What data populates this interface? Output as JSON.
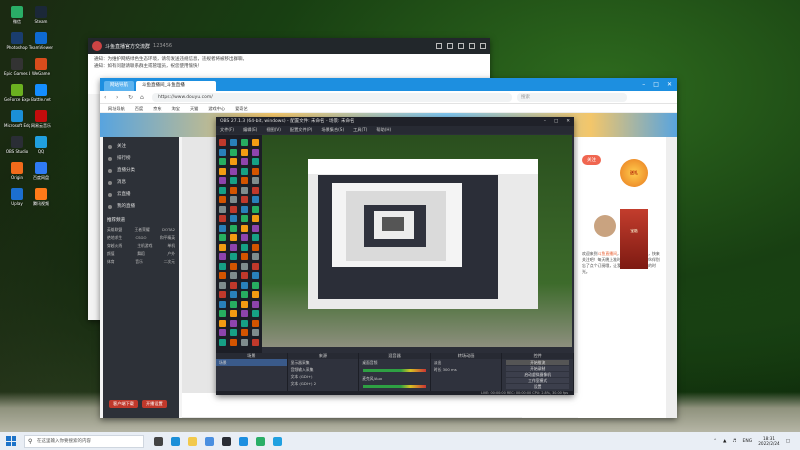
{
  "desktop": {
    "icons": [
      {
        "label": "微信",
        "color": "#2aae67"
      },
      {
        "label": "Photoshop",
        "color": "#1a3d6e"
      },
      {
        "label": "Epic Games Launcher",
        "color": "#333"
      },
      {
        "label": "GeForce Experience",
        "color": "#6bb120"
      },
      {
        "label": "Microsoft Edge",
        "color": "#1b8fd8"
      },
      {
        "label": "OBS Studio",
        "color": "#2a2d35"
      },
      {
        "label": "Origin",
        "color": "#f26b1b"
      },
      {
        "label": "Uplay",
        "color": "#1c6fd0"
      },
      {
        "label": "Steam",
        "color": "#1b2838"
      },
      {
        "label": "TeamViewer",
        "color": "#0e6ad1"
      },
      {
        "label": "WeGame",
        "color": "#d74c1c"
      },
      {
        "label": "Battle.net",
        "color": "#148eff"
      },
      {
        "label": "网易云音乐",
        "color": "#c20c0c"
      },
      {
        "label": "QQ",
        "color": "#20a0e0"
      },
      {
        "label": "百度网盘",
        "color": "#2f7bf5"
      },
      {
        "label": "腾讯视频",
        "color": "#ff7a19"
      }
    ],
    "taskbar": {
      "search_placeholder": "在这里输入你要搜索的内容",
      "tray_text": "ENG",
      "time": "18:31",
      "date": "2022/2/24"
    }
  },
  "chat_window": {
    "title": "斗鱼直播官方交流群",
    "group_id": "123456",
    "notices": [
      "通知：为维护网络绿色生态环境，请勿发送违规信息，违规者将被移出群聊。",
      "通知：如有问题请联系群主或管理员，祝您使用愉快！"
    ],
    "subheader": "斗鱼直播官方交流群"
  },
  "browser": {
    "tabs": [
      {
        "label": "网站导航"
      },
      {
        "label": "斗鱼直播间_斗鱼直播"
      }
    ],
    "address": "https://www.douyu.com/",
    "search_placeholder": "搜索",
    "bookmarks": [
      "网址导航",
      "百度",
      "京东",
      "淘宝",
      "天猫",
      "游戏中心",
      "爱奇艺"
    ],
    "sidebar": {
      "items": [
        "关注",
        "排行榜",
        "直播分类",
        "消息",
        "云直播",
        "我的直播"
      ],
      "group_title": "推荐频道",
      "grid": [
        [
          "英雄联盟",
          "王者荣耀",
          "DOTA2"
        ],
        [
          "绝地求生",
          "CSGO",
          "和平精英"
        ],
        [
          "穿越火线",
          "主机游戏",
          "单机"
        ],
        [
          "颜值",
          "舞蹈",
          "户外"
        ],
        [
          "体育",
          "音乐",
          "二次元"
        ]
      ],
      "actions": [
        "客户端下载",
        "开播设置"
      ]
    },
    "room": {
      "follow_label": "关注",
      "gift_label": "送礼",
      "redbox_label": "宝箱",
      "description_lead": "欢迎来到",
      "description_highlight": "斗鱼直播间",
      "description_rest": "，主播正在直播中，快来关注吧！每天晚上准时开播，喜欢的小伙伴别忘了点个订阅哦，让我们一起度过愉快的时光。"
    }
  },
  "obs": {
    "title": "OBS 27.1.3 (64-bit, windows) - 配置文件: 未命名 - 场景: 未命名",
    "menu": [
      "文件(F)",
      "编辑(E)",
      "视图(V)",
      "配置文件(P)",
      "场景集合(S)",
      "工具(T)",
      "帮助(H)"
    ],
    "docks": {
      "scenes": {
        "title": "场景",
        "rows": [
          "场景"
        ]
      },
      "sources": {
        "title": "来源",
        "rows": [
          "显示器采集",
          "音频输入采集",
          "文本 (GDI+)",
          "文本 (GDI+) 2"
        ]
      },
      "mixer": {
        "title": "混音器",
        "rows": [
          "桌面音频",
          "麦克风/Aux"
        ]
      },
      "transitions": {
        "title": "转场动画",
        "rows": [
          "淡出",
          "时长 300 ms"
        ]
      },
      "controls": {
        "title": "控件",
        "buttons": [
          "开始推流",
          "开始录制",
          "启动虚拟摄像机",
          "工作室模式",
          "设置",
          "退出"
        ]
      }
    },
    "status": "LIVE: 00:00:00   REC: 00:00:00   CPU: 2.8%, 30.00 fps"
  }
}
